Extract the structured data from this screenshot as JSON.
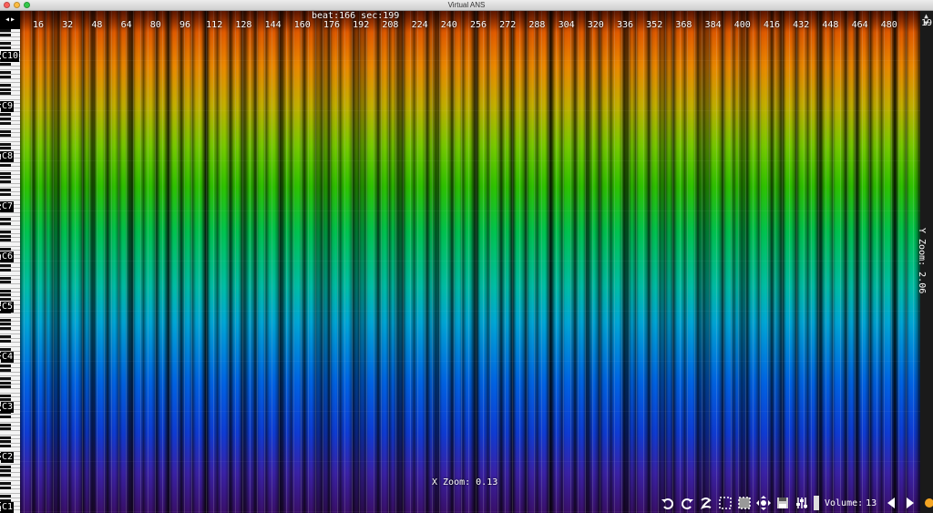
{
  "window": {
    "title": "Virtual ANS"
  },
  "ruler": {
    "ticks": [
      "16",
      "32",
      "48",
      "64",
      "80",
      "96",
      "112",
      "128",
      "144",
      "160",
      "176",
      "192",
      "208",
      "224",
      "240",
      "256",
      "272",
      "288",
      "304",
      "320",
      "336",
      "352",
      "368",
      "384",
      "400",
      "416",
      "432",
      "448",
      "464",
      "480"
    ],
    "end_label": "19",
    "beat_readout": "beat:166 sec:199"
  },
  "keyboard": {
    "octaves": [
      "C10",
      "C9",
      "C8",
      "C7",
      "C6",
      "C5",
      "C4",
      "C3",
      "C2",
      "C1"
    ],
    "nav_icon": "left-right-arrows"
  },
  "zoom": {
    "x_label": "X Zoom: 0.13",
    "y_label": "Y Zoom: 2.06"
  },
  "toolbar": {
    "icons": [
      "undo-icon",
      "redo-icon",
      "refresh-icon",
      "select-icon",
      "selection-mode-icon",
      "move-icon",
      "save-icon",
      "mixer-icon"
    ],
    "volume_label": "Volume:",
    "volume_value": "13",
    "accent": "#f5a623"
  },
  "colors": {
    "spectrum_top": "#a82800",
    "spectrum_mid": "#00c650",
    "spectrum_bottom": "#3a0f6a"
  }
}
